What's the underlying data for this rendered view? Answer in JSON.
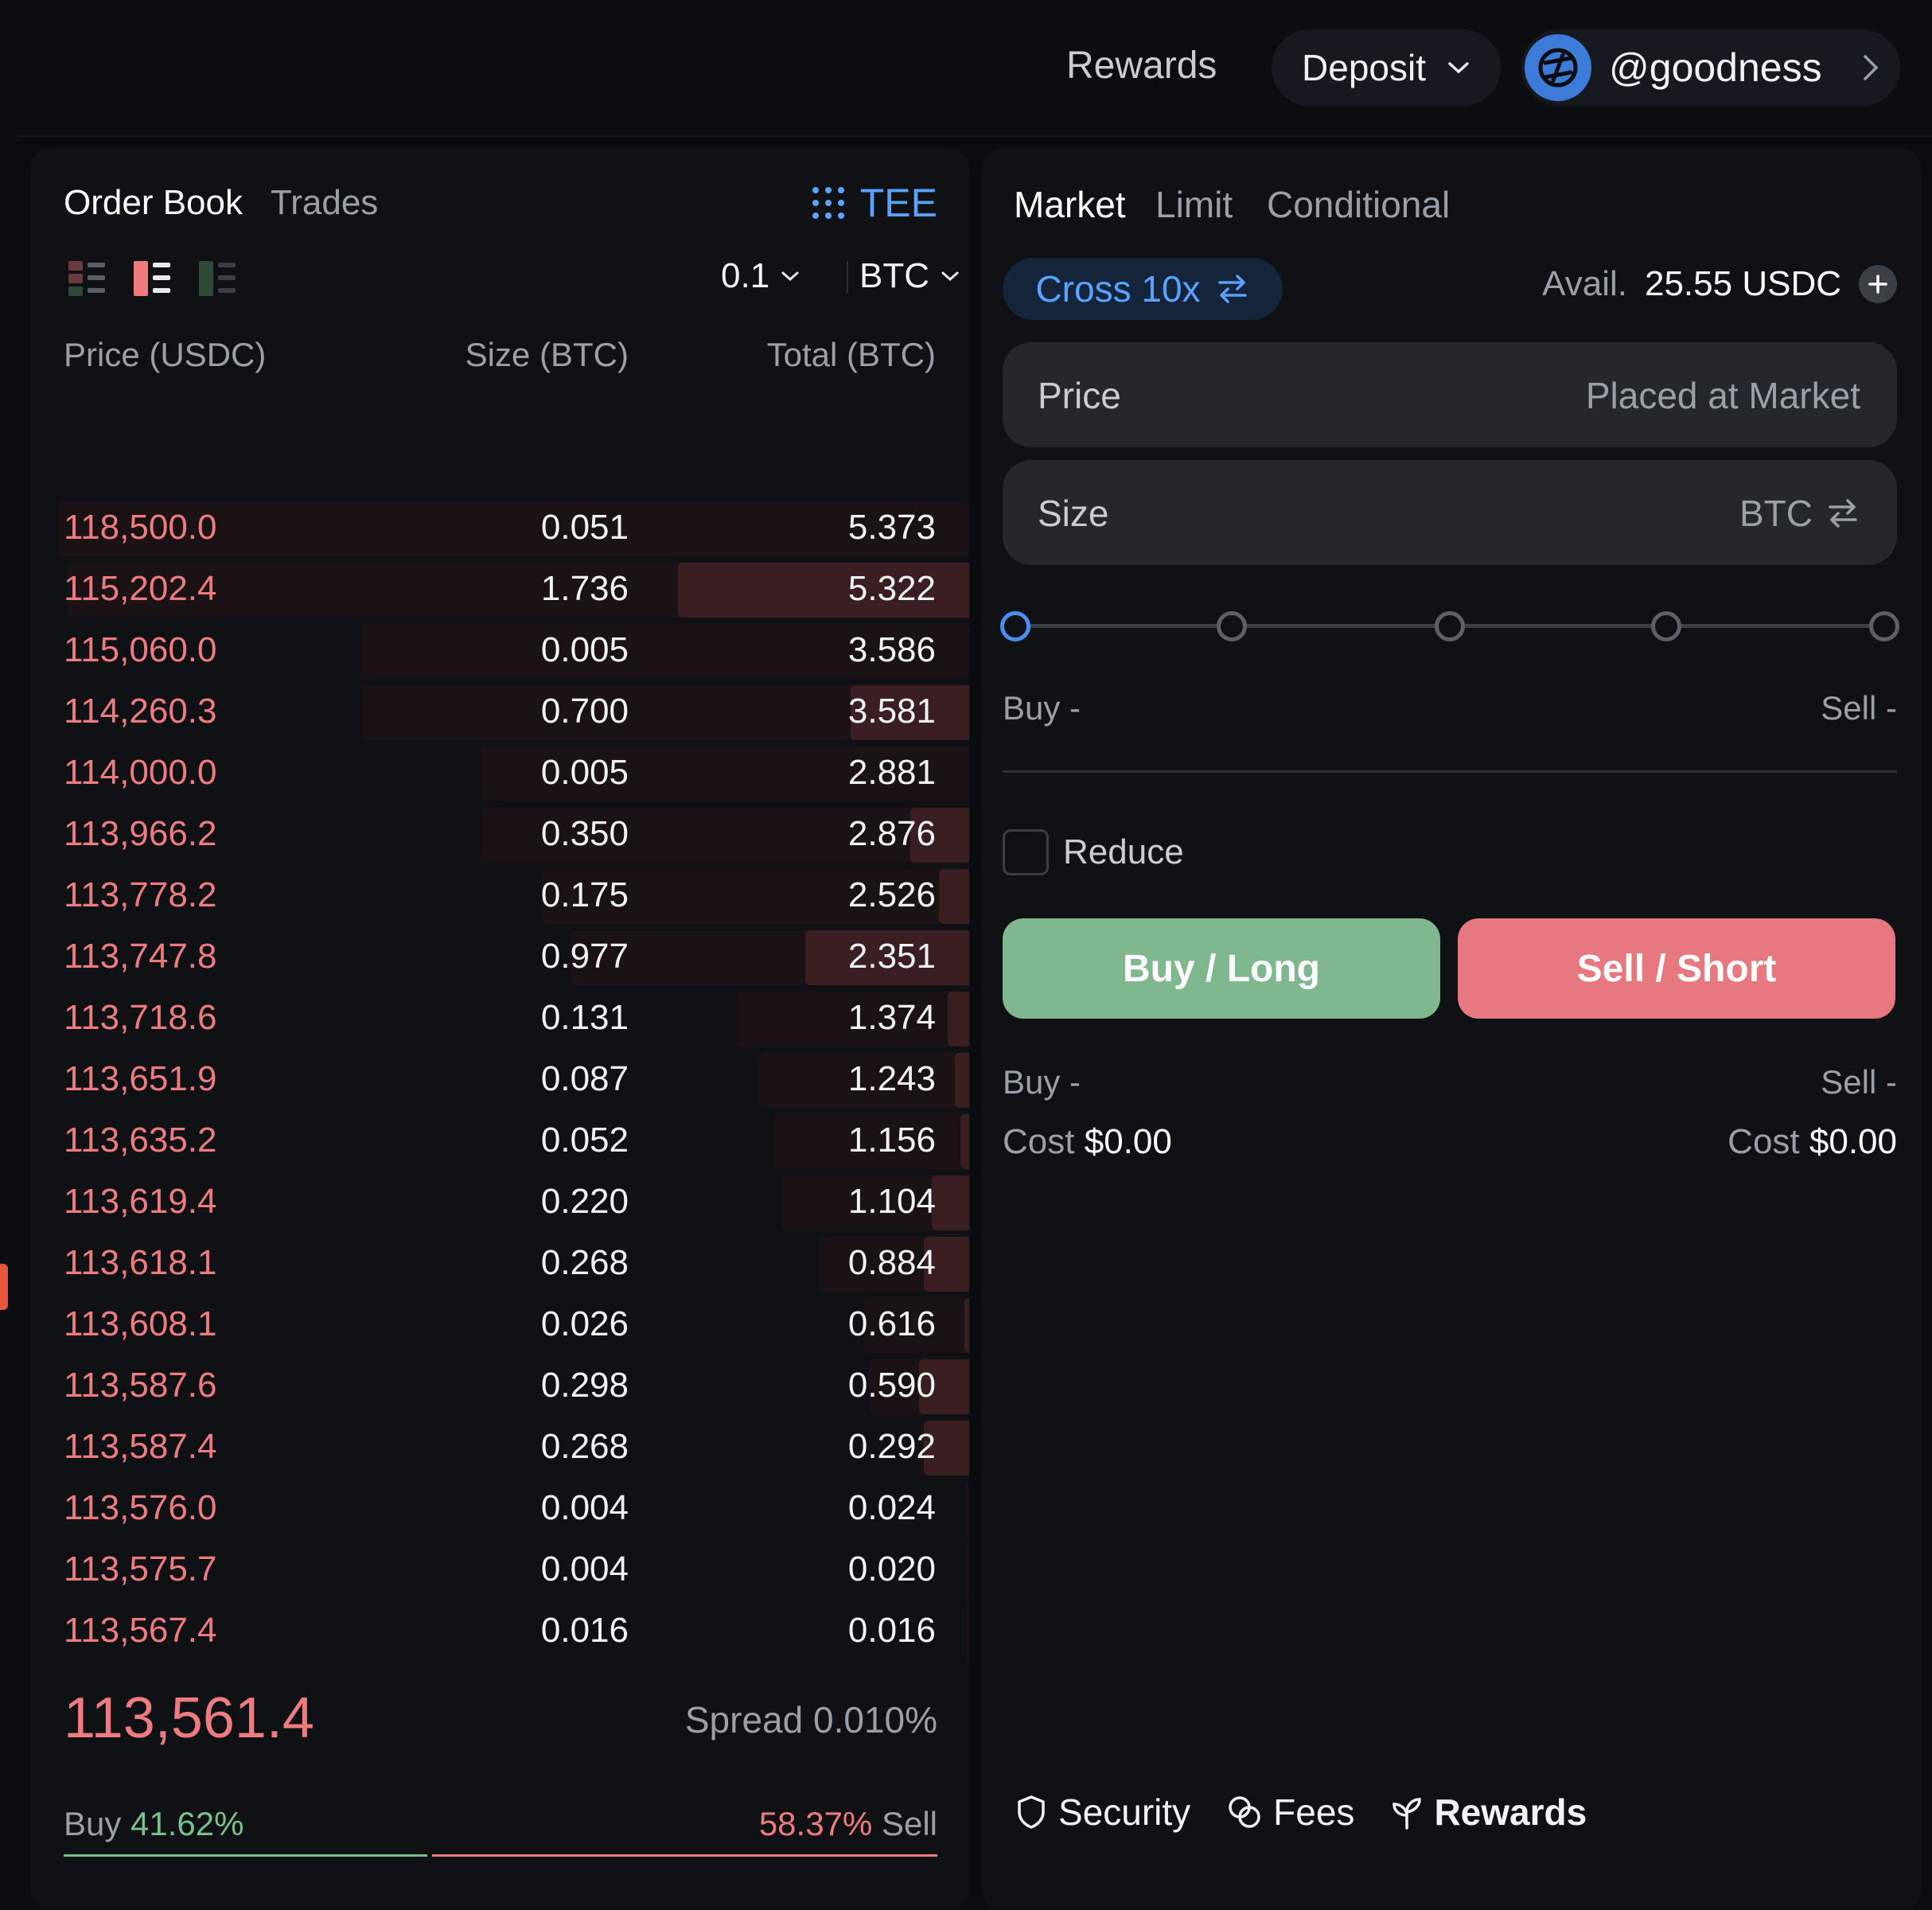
{
  "topbar": {
    "rewards": "Rewards",
    "deposit": "Deposit",
    "username": "@goodness"
  },
  "orderbook": {
    "tabs": [
      "Order Book",
      "Trades"
    ],
    "tee": "TEE",
    "tick": "0.1",
    "unit": "BTC",
    "columns": [
      "Price (USDC)",
      "Size (BTC)",
      "Total (BTC)"
    ],
    "asks": [
      {
        "price": "118,500.0",
        "size": "0.051",
        "total": "5.373",
        "depth": 1.0,
        "size_frac": 0.0
      },
      {
        "price": "115,202.4",
        "size": "1.736",
        "total": "5.322",
        "depth": 0.99,
        "size_frac": 0.32
      },
      {
        "price": "115,060.0",
        "size": "0.005",
        "total": "3.586",
        "depth": 0.667,
        "size_frac": 0.0
      },
      {
        "price": "114,260.3",
        "size": "0.700",
        "total": "3.581",
        "depth": 0.666,
        "size_frac": 0.13
      },
      {
        "price": "114,000.0",
        "size": "0.005",
        "total": "2.881",
        "depth": 0.536,
        "size_frac": 0.0
      },
      {
        "price": "113,966.2",
        "size": "0.350",
        "total": "2.876",
        "depth": 0.535,
        "size_frac": 0.065
      },
      {
        "price": "113,778.2",
        "size": "0.175",
        "total": "2.526",
        "depth": 0.47,
        "size_frac": 0.033
      },
      {
        "price": "113,747.8",
        "size": "0.977",
        "total": "2.351",
        "depth": 0.437,
        "size_frac": 0.18
      },
      {
        "price": "113,718.6",
        "size": "0.131",
        "total": "1.374",
        "depth": 0.256,
        "size_frac": 0.024
      },
      {
        "price": "113,651.9",
        "size": "0.087",
        "total": "1.243",
        "depth": 0.231,
        "size_frac": 0.016
      },
      {
        "price": "113,635.2",
        "size": "0.052",
        "total": "1.156",
        "depth": 0.215,
        "size_frac": 0.01
      },
      {
        "price": "113,619.4",
        "size": "0.220",
        "total": "1.104",
        "depth": 0.205,
        "size_frac": 0.041
      },
      {
        "price": "113,618.1",
        "size": "0.268",
        "total": "0.884",
        "depth": 0.164,
        "size_frac": 0.05
      },
      {
        "price": "113,608.1",
        "size": "0.026",
        "total": "0.616",
        "depth": 0.115,
        "size_frac": 0.005
      },
      {
        "price": "113,587.6",
        "size": "0.298",
        "total": "0.590",
        "depth": 0.11,
        "size_frac": 0.055
      },
      {
        "price": "113,587.4",
        "size": "0.268",
        "total": "0.292",
        "depth": 0.054,
        "size_frac": 0.05
      },
      {
        "price": "113,576.0",
        "size": "0.004",
        "total": "0.024",
        "depth": 0.004,
        "size_frac": 0.0
      },
      {
        "price": "113,575.7",
        "size": "0.004",
        "total": "0.020",
        "depth": 0.004,
        "size_frac": 0.0
      },
      {
        "price": "113,567.4",
        "size": "0.016",
        "total": "0.016",
        "depth": 0.003,
        "size_frac": 0.0
      }
    ],
    "last_price": "113,561.4",
    "spread_label": "Spread",
    "spread_value": "0.010%",
    "buy_label": "Buy",
    "buy_pct": "41.62%",
    "sell_label": "Sell",
    "sell_pct": "58.37%",
    "buy_ratio": 0.4162
  },
  "trade": {
    "tabs": [
      "Market",
      "Limit",
      "Conditional"
    ],
    "cross": "Cross 10x",
    "avail_label": "Avail.",
    "avail_value": "25.55 USDC",
    "price_label": "Price",
    "price_placeholder": "Placed at Market",
    "size_label": "Size",
    "size_unit": "BTC",
    "slider_value": 0,
    "buy_dash": "Buy -",
    "sell_dash": "Sell -",
    "reduce": "Reduce",
    "buy_button": "Buy / Long",
    "sell_button": "Sell / Short",
    "buy_dash2": "Buy -",
    "sell_dash2": "Sell -",
    "cost_label": "Cost",
    "buy_cost": "$0.00",
    "sell_cost": "$0.00",
    "footer": {
      "security": "Security",
      "fees": "Fees",
      "rewards": "Rewards"
    }
  },
  "colors": {
    "ask": "#ee7b80",
    "bid": "#78c08c",
    "accent": "#5aa2ff",
    "buy_btn": "#7fb78f",
    "sell_btn": "#e8787f"
  }
}
